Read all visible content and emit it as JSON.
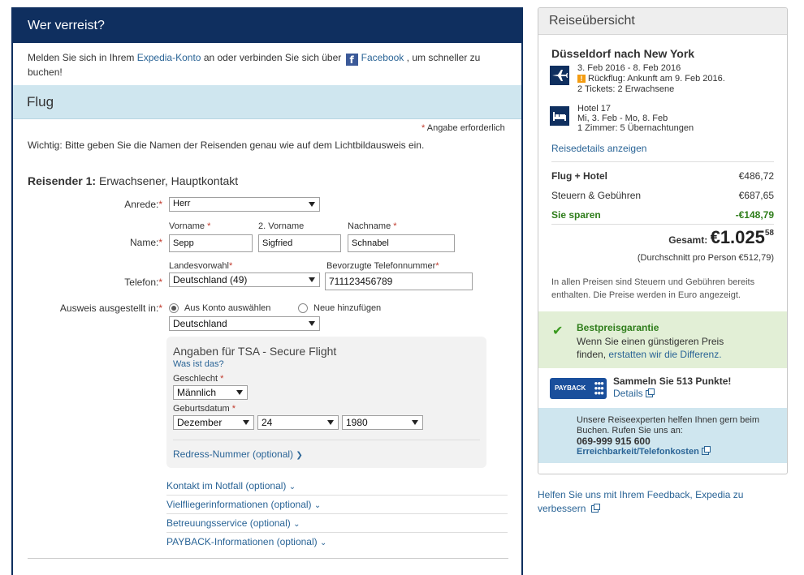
{
  "traveler_section": {
    "header": "Wer verreist?",
    "login_text_1": "Melden Sie sich in Ihrem",
    "login_link_account": "Expedia-Konto",
    "login_text_2": "an oder verbinden Sie sich über",
    "login_link_facebook": "Facebook",
    "login_text_3": ", um schneller zu",
    "login_text_4": "buchen!",
    "flight_header": "Flug",
    "required_note": "Angabe erforderlich",
    "important_note": "Wichtig: Bitte geben Sie die Namen der Reisenden genau wie auf dem Lichtbildausweis ein.",
    "traveler_title_bold": "Reisender 1:",
    "traveler_title_rest": "Erwachsener, Hauptkontakt",
    "salutation_label": "Anrede:",
    "salutation_value": "Herr",
    "name_label": "Name:",
    "firstname_label": "Vorname",
    "middlename_label": "2. Vorname",
    "lastname_label": "Nachname",
    "firstname_value": "Sepp",
    "middlename_value": "Sigfried",
    "lastname_value": "Schnabel",
    "phone_label": "Telefon:",
    "country_code_label": "Landesvorwahl",
    "country_code_value": "Deutschland (49)",
    "preferred_phone_label": "Bevorzugte Telefonnummer",
    "phone_value": "711123456789",
    "id_issued_label": "Ausweis ausgestellt in:",
    "radio_account": "Aus Konto auswählen",
    "radio_new": "Neue hinzufügen",
    "id_country_value": "Deutschland",
    "tsa": {
      "title": "Angaben für TSA - Secure Flight",
      "what_link": "Was ist das?",
      "gender_label": "Geschlecht",
      "gender_value": "Männlich",
      "birthdate_label": "Geburtsdatum",
      "birth_month": "Dezember",
      "birth_day": "24",
      "birth_year": "1980",
      "redress_link": "Redress-Nummer (optional)"
    },
    "optional_links": [
      "Kontakt im Notfall (optional)",
      "Vielfliegerinformationen (optional)",
      "Betreuungsservice (optional)",
      "PAYBACK-Informationen (optional)"
    ]
  },
  "summary": {
    "header": "Reiseübersicht",
    "route": "Düsseldorf nach New York",
    "flight_dates": "3. Feb 2016 - 8. Feb 2016",
    "return_note": "Rückflug: Ankunft am 9. Feb 2016.",
    "tickets": "2 Tickets: 2 Erwachsene",
    "hotel_name": "Hotel 17",
    "hotel_dates": "Mi, 3. Feb - Mo, 8. Feb",
    "hotel_rooms": "1 Zimmer: 5 Übernachtungen",
    "details_link": "Reisedetails anzeigen",
    "flight_hotel_label": "Flug + Hotel",
    "flight_hotel_value": "€486,72",
    "taxes_label": "Steuern & Gebühren",
    "taxes_value": "€687,65",
    "savings_label": "Sie sparen",
    "savings_value": "-€148,79",
    "total_label": "Gesamt:",
    "total_main": "€1.025",
    "total_cents": "58",
    "per_person": "(Durchschnitt pro Person €512,79)",
    "price_note_1": "In allen Preisen sind Steuern und Gebühren bereits",
    "price_note_2": "enthalten. Die Preise werden in Euro angezeigt.",
    "guarantee_title": "Bestpreisgarantie",
    "guarantee_text_1": "Wenn Sie einen günstigeren Preis",
    "guarantee_text_2": "finden,",
    "guarantee_link": "erstatten wir die Differenz.",
    "payback_logo": "PAYBACK",
    "payback_points": "Sammeln Sie 513 Punkte!",
    "payback_details": "Details",
    "expert_text_1": "Unsere Reiseexperten helfen Ihnen gern beim",
    "expert_text_2": "Buchen. Rufen Sie uns an:",
    "expert_phone": "069-999 915 600",
    "expert_link": "Erreichbarkeit/Telefonkosten"
  },
  "feedback": {
    "line_1": "Helfen Sie uns mit Ihrem Feedback, Expedia zu",
    "line_2": "verbessern"
  },
  "colors": {
    "navy": "#0f2f5f",
    "light_blue": "#cfe6ef",
    "link": "#2a6496",
    "green": "#2e7d1a",
    "required": "#c0392b"
  }
}
